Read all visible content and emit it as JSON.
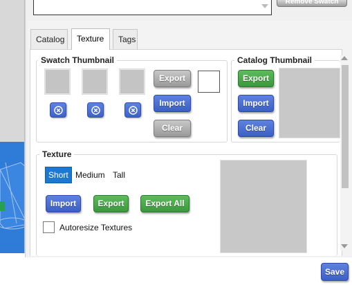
{
  "top": {
    "remove_button_label": "Remove Swatch"
  },
  "tabs": [
    {
      "label": "Catalog"
    },
    {
      "label": "Texture"
    },
    {
      "label": "Tags"
    }
  ],
  "active_tab": "Texture",
  "swatch_thumbnail": {
    "title": "Swatch Thumbnail",
    "slot_count": 3,
    "export_label": "Export",
    "import_label": "Import",
    "clear_label": "Clear"
  },
  "catalog_thumbnail": {
    "title": "Catalog Thumbnail",
    "export_label": "Export",
    "import_label": "Import",
    "clear_label": "Clear"
  },
  "texture": {
    "title": "Texture",
    "size_options": [
      "Short",
      "Medium",
      "Tall"
    ],
    "selected_size": "Short",
    "import_label": "Import",
    "export_label": "Export",
    "export_all_label": "Export All",
    "autoresize_label": "Autoresize Textures",
    "autoresize_checked": false
  },
  "footer": {
    "save_label": "Save"
  },
  "colors": {
    "blue_button": "#4a6fd6",
    "green_button": "#4aa84a",
    "gray_button": "#b0b0b0",
    "selected_option": "#1e78d2",
    "viewport_floor": "#2f7bd8"
  }
}
